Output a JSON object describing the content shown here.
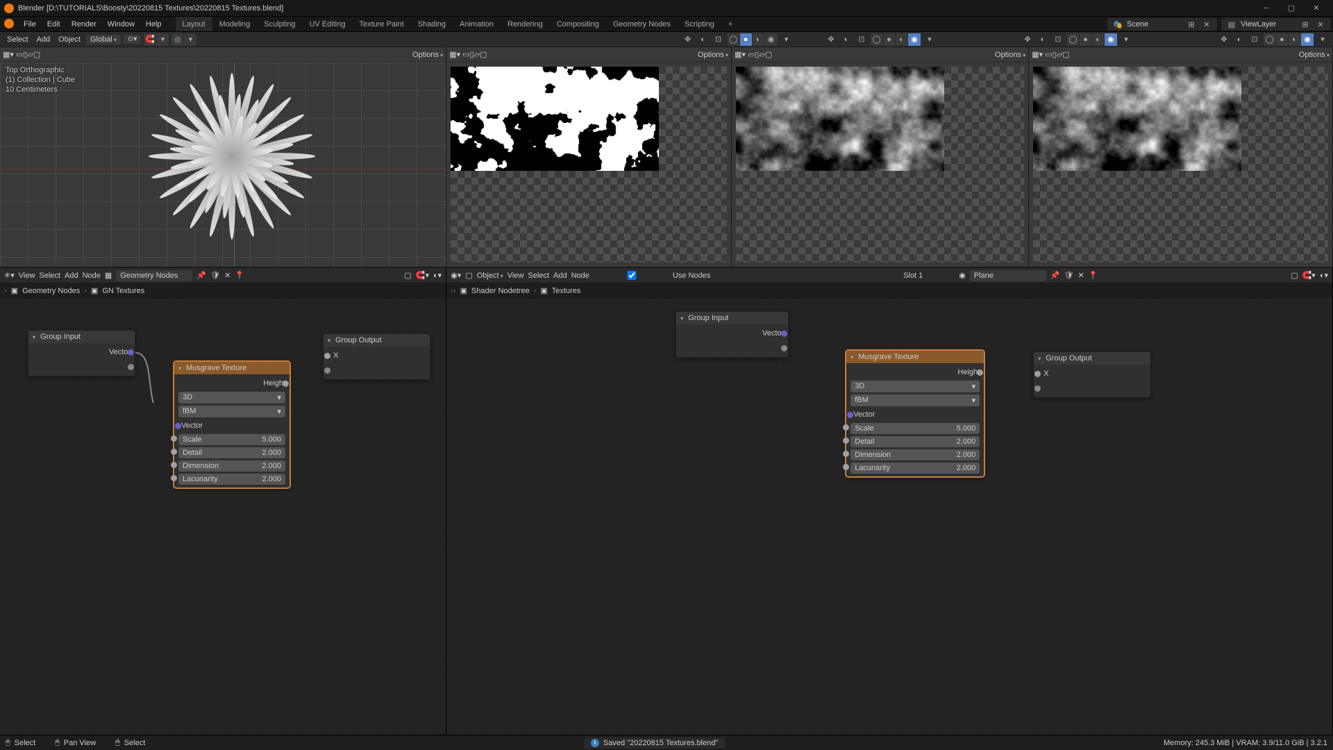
{
  "title": "Blender [D:\\TUTORIALS\\Boosty\\20220815 Textures\\20220815 Textures.blend]",
  "menu": {
    "file": "File",
    "edit": "Edit",
    "render": "Render",
    "window": "Window",
    "help": "Help"
  },
  "workspaces": [
    "Layout",
    "Modeling",
    "Sculpting",
    "UV Editing",
    "Texture Paint",
    "Shading",
    "Animation",
    "Rendering",
    "Compositing",
    "Geometry Nodes",
    "Scripting"
  ],
  "active_ws": "Layout",
  "scene_field": "Scene",
  "viewlayer_field": "ViewLayer",
  "vp0": {
    "toolhdr": {
      "select": "Select",
      "add": "Add",
      "object": "Object",
      "global": "Global"
    },
    "overlay": {
      "view": "Top Orthographic",
      "coll": "(1) Collection | Cube",
      "scale": "10 Centimeters"
    },
    "options": "Options"
  },
  "vp_opts": "Options",
  "geonode": {
    "hdr": {
      "view": "View",
      "select": "Select",
      "add": "Add",
      "node": "Node",
      "field": "Geometry Nodes"
    },
    "bc": {
      "root": "Geometry Nodes",
      "leaf": "GN Textures"
    },
    "group_input": {
      "title": "Group Input",
      "out0": "Vector"
    },
    "group_output": {
      "title": "Group Output",
      "in0": "X"
    },
    "musgrave": {
      "title": "Musgrave Texture",
      "out_height": "Height",
      "dim": "3D",
      "type": "fBM",
      "vector": "Vector",
      "scale_l": "Scale",
      "scale_v": "5.000",
      "detail_l": "Detail",
      "detail_v": "2.000",
      "dimension_l": "Dimension",
      "dimension_v": "2.000",
      "lacun_l": "Lacunarity",
      "lacun_v": "2.000"
    }
  },
  "shadernode": {
    "hdr": {
      "object_mode": "Object",
      "view": "View",
      "select": "Select",
      "add": "Add",
      "node": "Node",
      "use_nodes": "Use Nodes",
      "slot": "Slot 1",
      "mat": "Plane"
    },
    "bc": {
      "root": "Shader Nodetree",
      "leaf": "Textures"
    },
    "group_input": {
      "title": "Group Input",
      "out0": "Vector"
    },
    "group_output": {
      "title": "Group Output",
      "in0": "X"
    },
    "musgrave": {
      "title": "Musgrave Texture",
      "out_height": "Height",
      "dim": "3D",
      "type": "fBM",
      "vector": "Vector",
      "scale_l": "Scale",
      "scale_v": "5.000",
      "detail_l": "Detail",
      "detail_v": "2.000",
      "dimension_l": "Dimension",
      "dimension_v": "2.000",
      "lacun_l": "Lacunarity",
      "lacun_v": "2.000"
    }
  },
  "status": {
    "select": "Select",
    "pan": "Pan View",
    "select2": "Select",
    "saved": "Saved \"20220815 Textures.blend\"",
    "mem": "Memory: 245.3 MiB | VRAM: 3.9/11.0 GiB | 3.2.1"
  }
}
